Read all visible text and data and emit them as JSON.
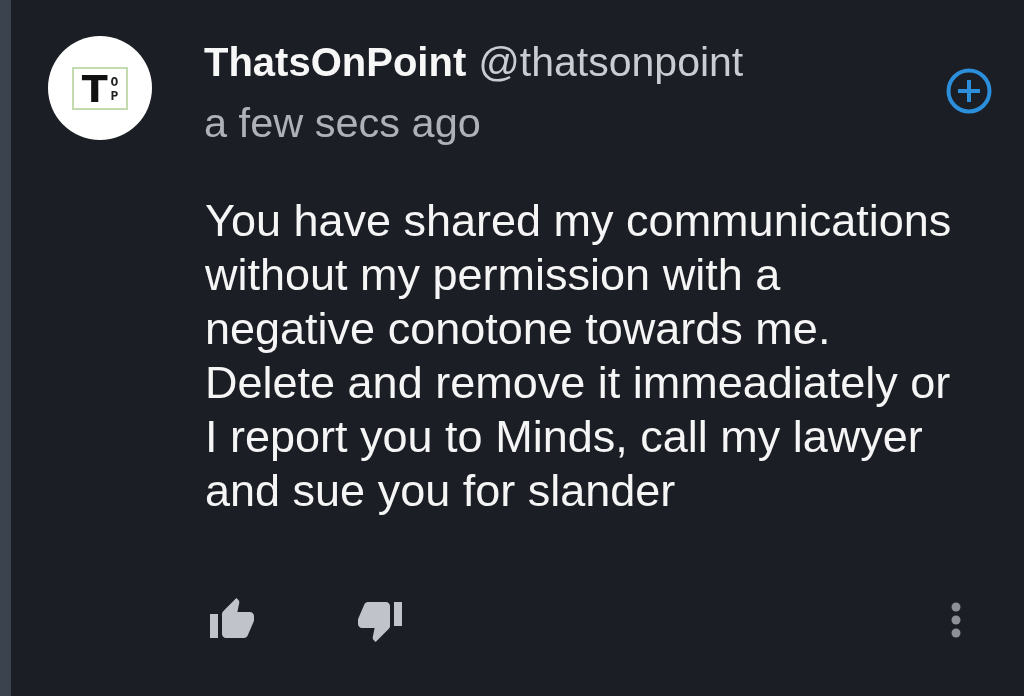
{
  "comment": {
    "author": {
      "avatar_logo": {
        "large_letter": "T",
        "small_letters": [
          "O",
          "P"
        ]
      },
      "name": "ThatsOnPoint",
      "handle": "@thatsonpoint"
    },
    "timestamp": "a few secs ago",
    "body": "You have shared my communications\nwithout my permission with a\nnegative conotone towards me.\nDelete and remove it immeadiately or\nI report you to Minds, call my lawyer\nand sue you for slander"
  }
}
